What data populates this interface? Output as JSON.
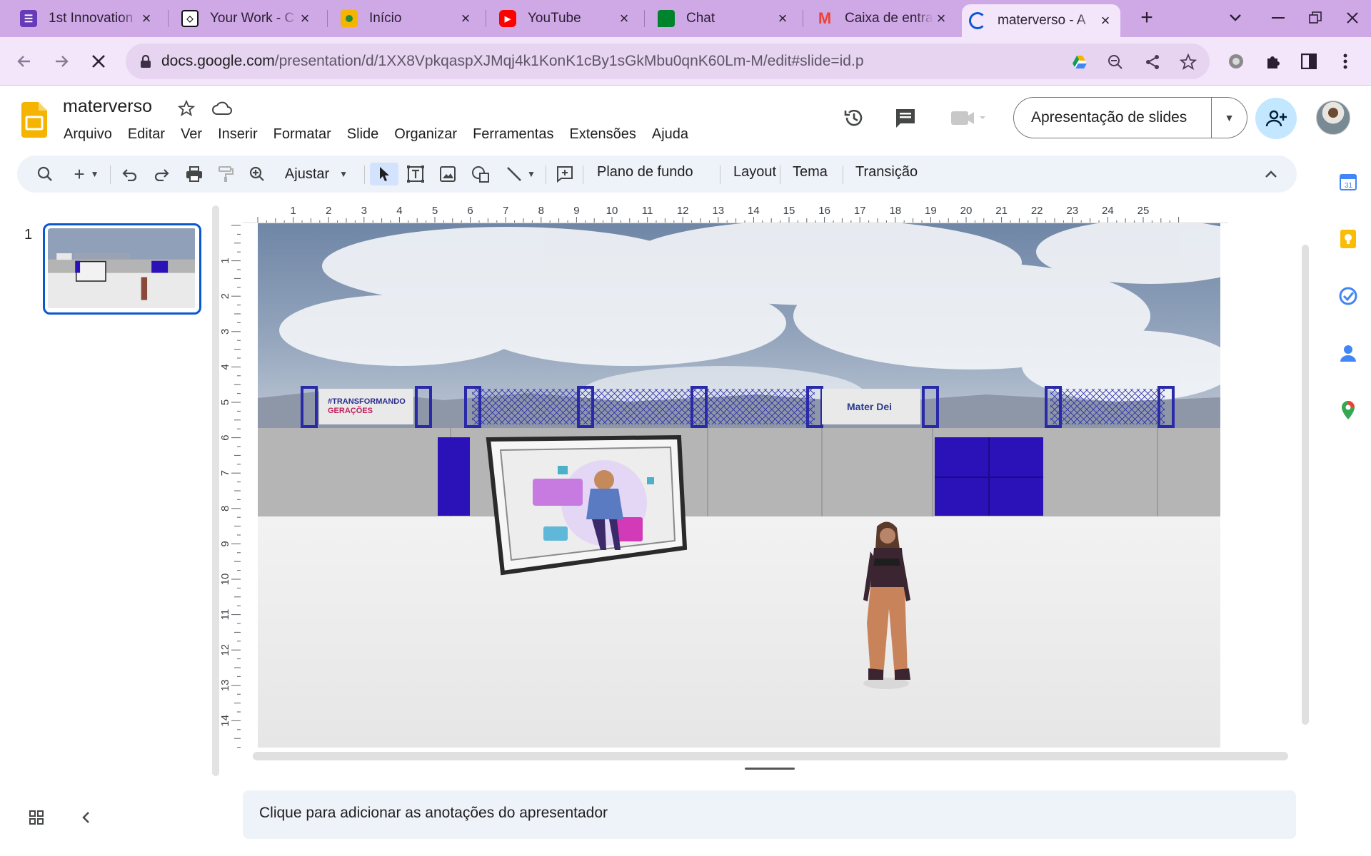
{
  "browser": {
    "tabs": [
      {
        "title": "1st Innovation",
        "favicon": "forms-icon",
        "color": "#673ab7"
      },
      {
        "title": "Your Work - C",
        "favicon": "codepen-icon",
        "color": "#ffffff"
      },
      {
        "title": "Início",
        "favicon": "classroom-icon",
        "color": "#f4b400"
      },
      {
        "title": "YouTube",
        "favicon": "youtube-icon",
        "color": "#ff0000"
      },
      {
        "title": "Chat",
        "favicon": "google-chat-icon",
        "color": "#00832d"
      },
      {
        "title": "Caixa de entra",
        "favicon": "gmail-icon",
        "color": "#ea4335"
      },
      {
        "title": "materverso - A",
        "favicon": "loading-icon",
        "color": "#0b57d0",
        "active": true
      }
    ],
    "url_host": "docs.google.com",
    "url_path": "/presentation/d/1XX8VpkqaspXJMqj4k1KonK1cBy1sGkMbu0qnK60Lm-M/edit#slide=id.p"
  },
  "doc": {
    "title": "materverso",
    "menu": [
      "Arquivo",
      "Editar",
      "Ver",
      "Inserir",
      "Formatar",
      "Slide",
      "Organizar",
      "Ferramentas",
      "Extensões",
      "Ajuda"
    ],
    "present_label": "Apresentação de slides"
  },
  "toolbar": {
    "zoom_label": "Ajustar",
    "background_label": "Plano de fundo",
    "layout_label": "Layout",
    "theme_label": "Tema",
    "transition_label": "Transição"
  },
  "filmstrip": {
    "slide_number": "1"
  },
  "ruler": {
    "horizontal": [
      "1",
      "2",
      "3",
      "4",
      "5",
      "6",
      "7",
      "8",
      "9",
      "10",
      "11",
      "12",
      "13",
      "14",
      "15",
      "16",
      "17",
      "18",
      "19",
      "20",
      "21",
      "22",
      "23",
      "24",
      "25"
    ],
    "vertical": [
      "1",
      "2",
      "3",
      "4",
      "5",
      "6",
      "7",
      "8",
      "9",
      "10",
      "11",
      "12",
      "13",
      "14"
    ]
  },
  "slide": {
    "banner_left_line1": "#TRANSFORMANDO",
    "banner_left_line2": "GERAÇÕES",
    "banner_right": "Mater Dei"
  },
  "notes": {
    "placeholder": "Clique para adicionar as anotações do apresentador"
  },
  "colors": {
    "accent": "#0b57d0",
    "tab_strip": "#cfa9e6",
    "slides_yellow": "#f4b400",
    "wall_blue": "#2a12b8"
  }
}
